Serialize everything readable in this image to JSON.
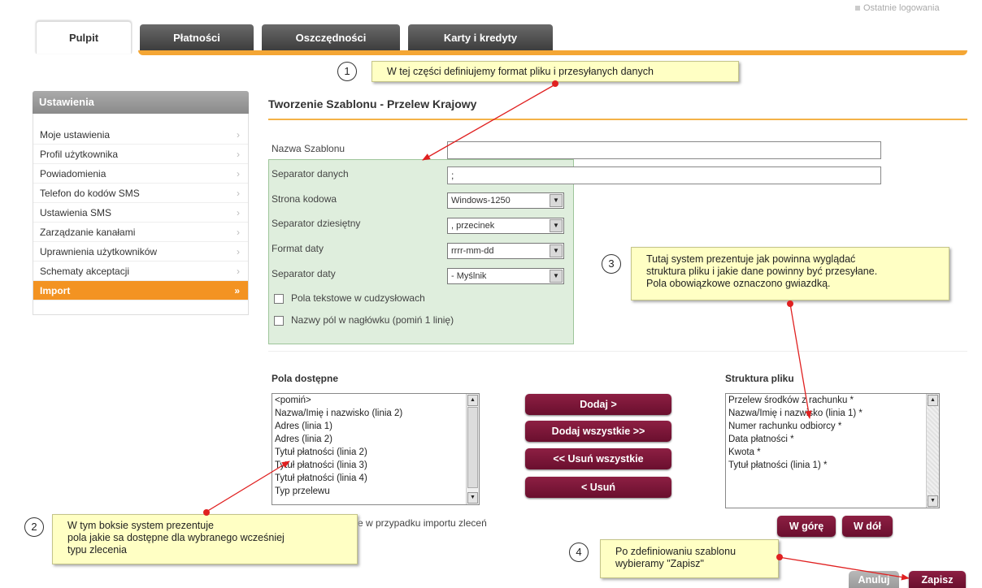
{
  "header": {
    "logout_text": "Ostatnie logowania"
  },
  "tabs": [
    {
      "label": "Pulpit"
    },
    {
      "label": "Płatności"
    },
    {
      "label": "Oszczędności"
    },
    {
      "label": "Karty i kredyty"
    }
  ],
  "sidebar": {
    "title": "Ustawienia",
    "items": [
      {
        "label": "Moje ustawienia",
        "arrow": "›"
      },
      {
        "label": "Profil użytkownika",
        "arrow": "›"
      },
      {
        "label": "Powiadomienia",
        "arrow": "›"
      },
      {
        "label": "Telefon do kodów SMS",
        "arrow": "›"
      },
      {
        "label": "Ustawienia SMS",
        "arrow": "›"
      },
      {
        "label": "Zarządzanie kanałami",
        "arrow": "›"
      },
      {
        "label": "Uprawnienia użytkowników",
        "arrow": "›"
      },
      {
        "label": "Schematy akceptacji",
        "arrow": "›"
      },
      {
        "label": "Import",
        "arrow": "»"
      }
    ]
  },
  "main": {
    "title": "Tworzenie Szablonu - Przelew Krajowy",
    "form": {
      "name_label": "Nazwa Szablonu",
      "name_value": "",
      "separator_label": "Separator danych",
      "separator_value": ";",
      "codepage_label": "Strona kodowa",
      "codepage_value": "Windows-1250",
      "decimal_label": "Separator dziesiętny",
      "decimal_value": ", przecinek",
      "dateformat_label": "Format daty",
      "dateformat_value": "rrrr-mm-dd",
      "dateseparator_label": "Separator daty",
      "dateseparator_value": "- Myślnik",
      "quoted_label": "Pola tekstowe w cudzysłowach",
      "header_label": "Nazwy pól w nagłówku (pomiń 1 linię)"
    },
    "available": {
      "title": "Pola dostępne",
      "items": [
        "<pomiń>",
        "Nazwa/Imię i nazwisko (linia 2)",
        "Adres (linia 1)",
        "Adres (linia 2)",
        "Tytuł płatności (linia 2)",
        "Tytuł płatności (linia 3)",
        "Tytuł płatności (linia 4)",
        "Typ przelewu"
      ],
      "note_fragment": "e w przypadku importu zleceń"
    },
    "buttons": {
      "add": "Dodaj >",
      "add_all": "Dodaj wszystkie >>",
      "remove_all": "<< Usuń wszystkie",
      "remove": "< Usuń",
      "up": "W górę",
      "down": "W dół",
      "cancel": "Anuluj",
      "save": "Zapisz"
    },
    "structure": {
      "title": "Struktura pliku",
      "items": [
        "Przelew środków z rachunku *",
        "Nazwa/Imię i nazwisko (linia 1) *",
        "Numer rachunku odbiorcy *",
        "Data płatności *",
        "Kwota *",
        "Tytuł płatności (linia 1) *"
      ]
    }
  },
  "annotations": [
    {
      "number": "1",
      "text": "W tej części definiujemy format pliku i przesyłanych danych"
    },
    {
      "number": "2",
      "lines": [
        "W tym boksie system prezentuje",
        "pola jakie sa dostępne dla wybranego wcześniej",
        "typu zlecenia"
      ]
    },
    {
      "number": "3",
      "lines": [
        "Tutaj system prezentuje jak powinna wyglądać",
        "struktura pliku i jakie dane powinny być przesyłane.",
        "Pola obowiązkowe oznaczono gwiazdką."
      ]
    },
    {
      "number": "4",
      "lines": [
        "Po zdefiniowaniu szablonu",
        "wybieramy \"Zapisz\""
      ]
    }
  ],
  "colors": {
    "accent_orange": "#f39322",
    "button_maroon": "#7a1535",
    "form_green": "#dfeedd",
    "note_yellow": "#ffffc4",
    "arrow_red": "#e02020"
  }
}
